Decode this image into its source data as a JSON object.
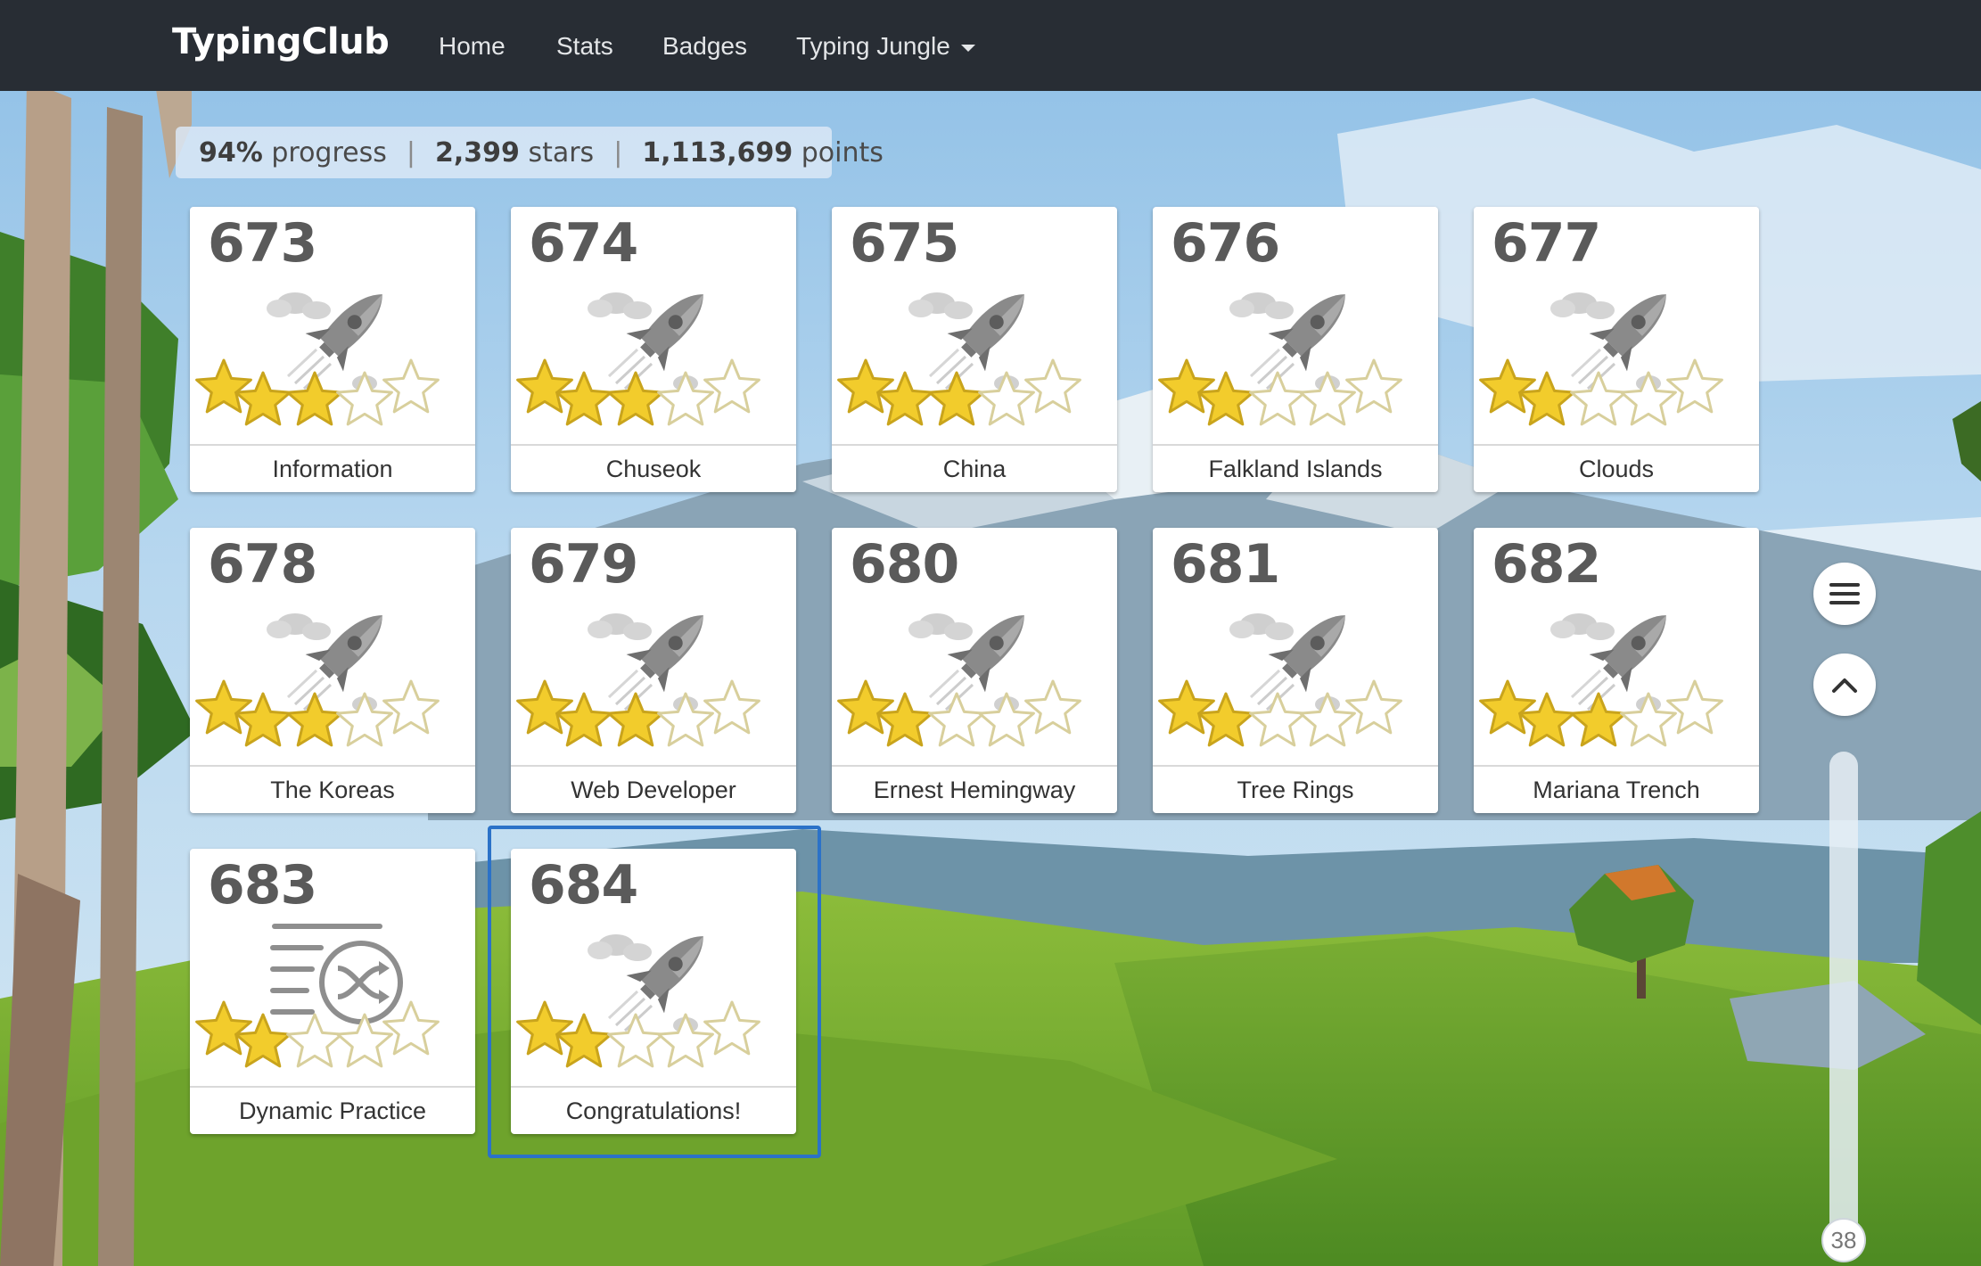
{
  "brand": "TypingClub",
  "nav": {
    "home": "Home",
    "stats": "Stats",
    "badges": "Badges",
    "course": "Typing Jungle"
  },
  "stats": {
    "progress_value": "94%",
    "progress_label": "progress",
    "stars_value": "2,399",
    "stars_label": "stars",
    "points_value": "1,113,699",
    "points_label": "points"
  },
  "lessons": [
    {
      "number": "673",
      "title": "Information",
      "stars": 3,
      "icon": "rocket-icon"
    },
    {
      "number": "674",
      "title": "Chuseok",
      "stars": 3,
      "icon": "rocket-icon"
    },
    {
      "number": "675",
      "title": "China",
      "stars": 3,
      "icon": "rocket-icon"
    },
    {
      "number": "676",
      "title": "Falkland Islands",
      "stars": 2,
      "icon": "rocket-icon"
    },
    {
      "number": "677",
      "title": "Clouds",
      "stars": 2,
      "icon": "rocket-icon"
    },
    {
      "number": "678",
      "title": "The Koreas",
      "stars": 3,
      "icon": "rocket-icon"
    },
    {
      "number": "679",
      "title": "Web Developer",
      "stars": 3,
      "icon": "rocket-icon"
    },
    {
      "number": "680",
      "title": "Ernest Hemingway",
      "stars": 2,
      "icon": "rocket-icon"
    },
    {
      "number": "681",
      "title": "Tree Rings",
      "stars": 2,
      "icon": "rocket-icon"
    },
    {
      "number": "682",
      "title": "Mariana Trench",
      "stars": 3,
      "icon": "rocket-icon"
    },
    {
      "number": "683",
      "title": "Dynamic Practice",
      "stars": 2,
      "icon": "shuffle-icon"
    },
    {
      "number": "684",
      "title": "Congratulations!",
      "stars": 2,
      "icon": "rocket-icon"
    }
  ],
  "max_stars": 5,
  "selected_lesson": "684",
  "page_indicator": "38",
  "colors": {
    "navbar": "#282d34",
    "star_filled": "#f2cc2c",
    "focus_ring": "#2b72c8",
    "number_text": "#5a5a5a"
  }
}
